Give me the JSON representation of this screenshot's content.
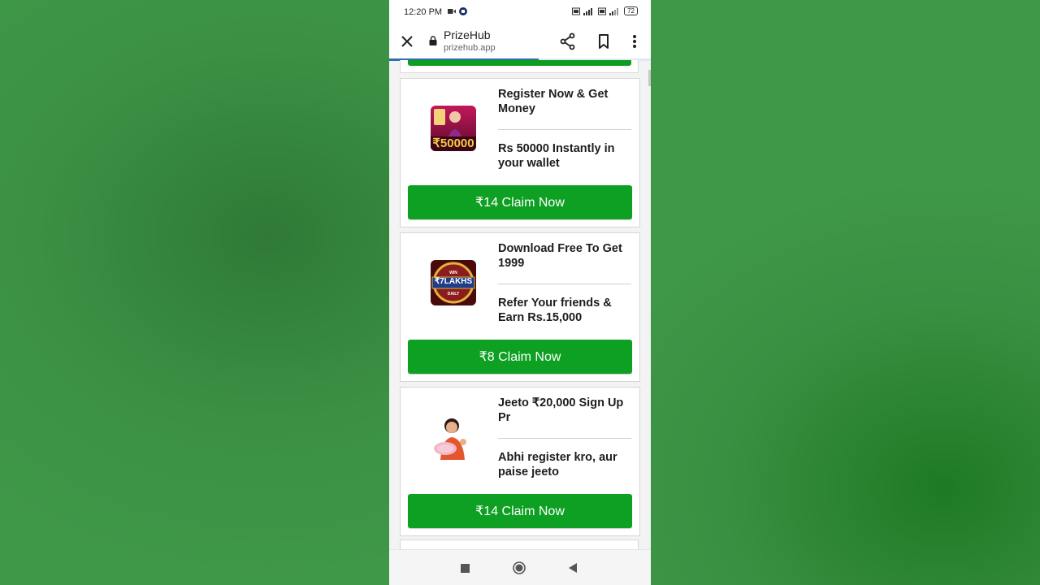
{
  "status_bar": {
    "time": "12:20 PM",
    "battery": "72",
    "icons": [
      "video-camera-icon",
      "app-notification-icon",
      "volte-icon",
      "signal-icon",
      "battery-icon"
    ]
  },
  "browser": {
    "title": "PrizeHub",
    "url": "prizehub.app",
    "load_progress": 0.57,
    "icons": [
      "close-icon",
      "lock-icon",
      "share-icon",
      "bookmark-icon",
      "more-vert-icon"
    ]
  },
  "offers": [
    {
      "title": "Register Now & Get Money",
      "description": "Rs 50000 Instantly in your wallet",
      "button_label": "₹14 Claim Now",
      "image_text": "₹50000"
    },
    {
      "title": "Download Free To Get 1999",
      "description": "Refer Your friends & Earn Rs.15,000",
      "button_label": "₹8 Claim Now",
      "image_text": "₹7LAKHS"
    },
    {
      "title": "Jeeto ₹20,000 Sign Up Pr",
      "description": "Abhi register kro, aur paise jeeto",
      "button_label": "₹14 Claim Now",
      "image_text": ""
    }
  ],
  "nav_bar": {
    "icons": [
      "recent-apps-icon",
      "home-icon",
      "back-icon"
    ]
  },
  "colors": {
    "claim_button": "#0ea022",
    "background_green": "#3f9748",
    "progress_blue": "#2f6fb0"
  }
}
